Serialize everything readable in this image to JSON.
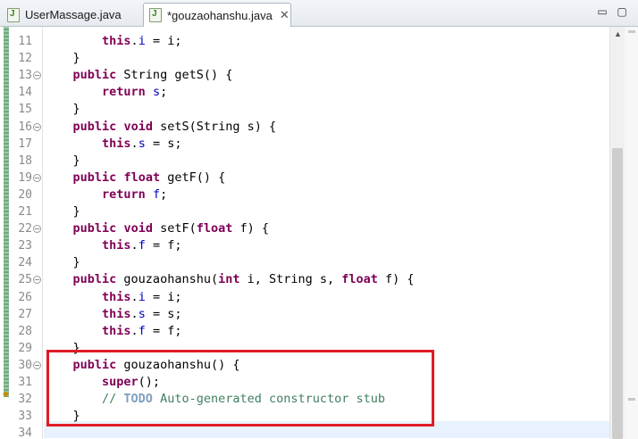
{
  "tabs": [
    {
      "label": "UserMassage.java",
      "active": false
    },
    {
      "label": "*gouzaohanshu.java",
      "active": true,
      "close": "✕"
    }
  ],
  "window_controls": {
    "minimize": "▭",
    "maximize": "▢"
  },
  "colors": {
    "keyword": "#7f0055",
    "field": "#0000c0",
    "comment": "#3f7f5f",
    "todo": "#7f9fbf",
    "highlight_box": "#e01b24",
    "current_line": "#e8f2fe"
  },
  "editor": {
    "highlighted_lines": [
      30,
      33
    ],
    "current_line": 34,
    "lines": [
      {
        "n": "11",
        "fold": false,
        "tokens": [
          [
            "        ",
            ""
          ],
          [
            "this",
            "kw"
          ],
          [
            ".",
            ""
          ],
          [
            "i",
            "fld"
          ],
          [
            " = i;",
            ""
          ]
        ]
      },
      {
        "n": "12",
        "fold": false,
        "tokens": [
          [
            "    }",
            ""
          ]
        ]
      },
      {
        "n": "13",
        "fold": true,
        "tokens": [
          [
            "    ",
            ""
          ],
          [
            "public",
            "kw"
          ],
          [
            " String getS() {",
            ""
          ]
        ]
      },
      {
        "n": "14",
        "fold": false,
        "tokens": [
          [
            "        ",
            ""
          ],
          [
            "return",
            "kw"
          ],
          [
            " ",
            ""
          ],
          [
            "s",
            "fld"
          ],
          [
            ";",
            ""
          ]
        ]
      },
      {
        "n": "15",
        "fold": false,
        "tokens": [
          [
            "    }",
            ""
          ]
        ]
      },
      {
        "n": "16",
        "fold": true,
        "tokens": [
          [
            "    ",
            ""
          ],
          [
            "public",
            "kw"
          ],
          [
            " ",
            ""
          ],
          [
            "void",
            "kw"
          ],
          [
            " setS(String s) {",
            ""
          ]
        ]
      },
      {
        "n": "17",
        "fold": false,
        "tokens": [
          [
            "        ",
            ""
          ],
          [
            "this",
            "kw"
          ],
          [
            ".",
            ""
          ],
          [
            "s",
            "fld"
          ],
          [
            " = s;",
            ""
          ]
        ]
      },
      {
        "n": "18",
        "fold": false,
        "tokens": [
          [
            "    }",
            ""
          ]
        ]
      },
      {
        "n": "19",
        "fold": true,
        "tokens": [
          [
            "    ",
            ""
          ],
          [
            "public",
            "kw"
          ],
          [
            " ",
            ""
          ],
          [
            "float",
            "kw"
          ],
          [
            " getF() {",
            ""
          ]
        ]
      },
      {
        "n": "20",
        "fold": false,
        "tokens": [
          [
            "        ",
            ""
          ],
          [
            "return",
            "kw"
          ],
          [
            " ",
            ""
          ],
          [
            "f",
            "fld"
          ],
          [
            ";",
            ""
          ]
        ]
      },
      {
        "n": "21",
        "fold": false,
        "tokens": [
          [
            "    }",
            ""
          ]
        ]
      },
      {
        "n": "22",
        "fold": true,
        "tokens": [
          [
            "    ",
            ""
          ],
          [
            "public",
            "kw"
          ],
          [
            " ",
            ""
          ],
          [
            "void",
            "kw"
          ],
          [
            " setF(",
            ""
          ],
          [
            "float",
            "kw"
          ],
          [
            " f) {",
            ""
          ]
        ]
      },
      {
        "n": "23",
        "fold": false,
        "tokens": [
          [
            "        ",
            ""
          ],
          [
            "this",
            "kw"
          ],
          [
            ".",
            ""
          ],
          [
            "f",
            "fld"
          ],
          [
            " = f;",
            ""
          ]
        ]
      },
      {
        "n": "24",
        "fold": false,
        "tokens": [
          [
            "    }",
            ""
          ]
        ]
      },
      {
        "n": "25",
        "fold": true,
        "tokens": [
          [
            "    ",
            ""
          ],
          [
            "public",
            "kw"
          ],
          [
            " gouzaohanshu(",
            ""
          ],
          [
            "int",
            "kw"
          ],
          [
            " i, String s, ",
            ""
          ],
          [
            "float",
            "kw"
          ],
          [
            " f) {",
            ""
          ]
        ]
      },
      {
        "n": "26",
        "fold": false,
        "tokens": [
          [
            "        ",
            ""
          ],
          [
            "this",
            "kw"
          ],
          [
            ".",
            ""
          ],
          [
            "i",
            "fld"
          ],
          [
            " = i;",
            ""
          ]
        ]
      },
      {
        "n": "27",
        "fold": false,
        "tokens": [
          [
            "        ",
            ""
          ],
          [
            "this",
            "kw"
          ],
          [
            ".",
            ""
          ],
          [
            "s",
            "fld"
          ],
          [
            " = s;",
            ""
          ]
        ]
      },
      {
        "n": "28",
        "fold": false,
        "tokens": [
          [
            "        ",
            ""
          ],
          [
            "this",
            "kw"
          ],
          [
            ".",
            ""
          ],
          [
            "f",
            "fld"
          ],
          [
            " = f;",
            ""
          ]
        ]
      },
      {
        "n": "29",
        "fold": false,
        "tokens": [
          [
            "    }",
            ""
          ]
        ]
      },
      {
        "n": "30",
        "fold": true,
        "tokens": [
          [
            "    ",
            ""
          ],
          [
            "public",
            "kw"
          ],
          [
            " gouzaohanshu() {",
            ""
          ]
        ]
      },
      {
        "n": "31",
        "fold": false,
        "tokens": [
          [
            "        ",
            ""
          ],
          [
            "super",
            "kw"
          ],
          [
            "();",
            ""
          ]
        ]
      },
      {
        "n": "32",
        "fold": false,
        "tokens": [
          [
            "        ",
            ""
          ],
          [
            "// ",
            "cm"
          ],
          [
            "TODO",
            "todo"
          ],
          [
            " Auto-generated constructor stub",
            "cm"
          ]
        ]
      },
      {
        "n": "33",
        "fold": false,
        "tokens": [
          [
            "    }",
            ""
          ]
        ]
      },
      {
        "n": "34",
        "fold": false,
        "tokens": []
      }
    ]
  }
}
